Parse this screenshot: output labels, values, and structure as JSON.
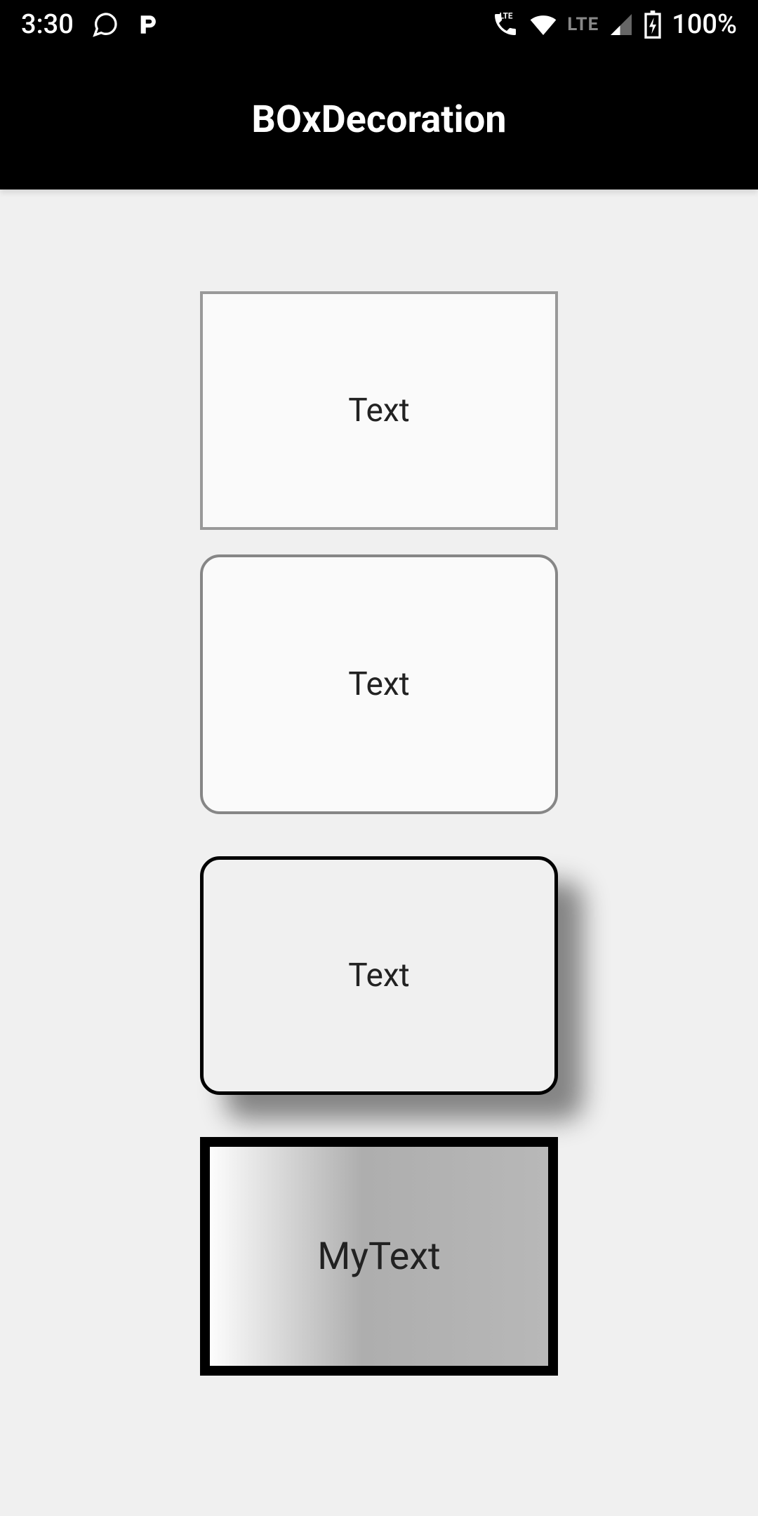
{
  "status": {
    "time": "3:30",
    "battery_pct": "100%"
  },
  "app": {
    "title": "BOxDecoration"
  },
  "boxes": {
    "b1": "Text",
    "b2": "Text",
    "b3": "Text",
    "b4": "MyText"
  }
}
